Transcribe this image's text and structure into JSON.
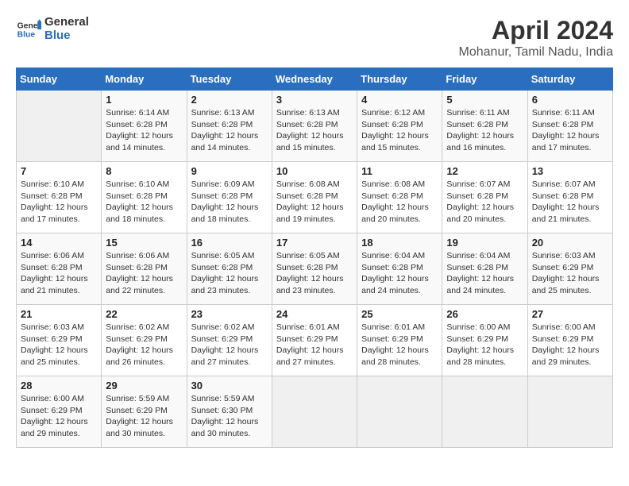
{
  "header": {
    "logo_line1": "General",
    "logo_line2": "Blue",
    "title": "April 2024",
    "subtitle": "Mohanur, Tamil Nadu, India"
  },
  "columns": [
    "Sunday",
    "Monday",
    "Tuesday",
    "Wednesday",
    "Thursday",
    "Friday",
    "Saturday"
  ],
  "rows": [
    [
      {
        "day": "",
        "info": ""
      },
      {
        "day": "1",
        "info": "Sunrise: 6:14 AM\nSunset: 6:28 PM\nDaylight: 12 hours\nand 14 minutes."
      },
      {
        "day": "2",
        "info": "Sunrise: 6:13 AM\nSunset: 6:28 PM\nDaylight: 12 hours\nand 14 minutes."
      },
      {
        "day": "3",
        "info": "Sunrise: 6:13 AM\nSunset: 6:28 PM\nDaylight: 12 hours\nand 15 minutes."
      },
      {
        "day": "4",
        "info": "Sunrise: 6:12 AM\nSunset: 6:28 PM\nDaylight: 12 hours\nand 15 minutes."
      },
      {
        "day": "5",
        "info": "Sunrise: 6:11 AM\nSunset: 6:28 PM\nDaylight: 12 hours\nand 16 minutes."
      },
      {
        "day": "6",
        "info": "Sunrise: 6:11 AM\nSunset: 6:28 PM\nDaylight: 12 hours\nand 17 minutes."
      }
    ],
    [
      {
        "day": "7",
        "info": "Sunrise: 6:10 AM\nSunset: 6:28 PM\nDaylight: 12 hours\nand 17 minutes."
      },
      {
        "day": "8",
        "info": "Sunrise: 6:10 AM\nSunset: 6:28 PM\nDaylight: 12 hours\nand 18 minutes."
      },
      {
        "day": "9",
        "info": "Sunrise: 6:09 AM\nSunset: 6:28 PM\nDaylight: 12 hours\nand 18 minutes."
      },
      {
        "day": "10",
        "info": "Sunrise: 6:08 AM\nSunset: 6:28 PM\nDaylight: 12 hours\nand 19 minutes."
      },
      {
        "day": "11",
        "info": "Sunrise: 6:08 AM\nSunset: 6:28 PM\nDaylight: 12 hours\nand 20 minutes."
      },
      {
        "day": "12",
        "info": "Sunrise: 6:07 AM\nSunset: 6:28 PM\nDaylight: 12 hours\nand 20 minutes."
      },
      {
        "day": "13",
        "info": "Sunrise: 6:07 AM\nSunset: 6:28 PM\nDaylight: 12 hours\nand 21 minutes."
      }
    ],
    [
      {
        "day": "14",
        "info": "Sunrise: 6:06 AM\nSunset: 6:28 PM\nDaylight: 12 hours\nand 21 minutes."
      },
      {
        "day": "15",
        "info": "Sunrise: 6:06 AM\nSunset: 6:28 PM\nDaylight: 12 hours\nand 22 minutes."
      },
      {
        "day": "16",
        "info": "Sunrise: 6:05 AM\nSunset: 6:28 PM\nDaylight: 12 hours\nand 23 minutes."
      },
      {
        "day": "17",
        "info": "Sunrise: 6:05 AM\nSunset: 6:28 PM\nDaylight: 12 hours\nand 23 minutes."
      },
      {
        "day": "18",
        "info": "Sunrise: 6:04 AM\nSunset: 6:28 PM\nDaylight: 12 hours\nand 24 minutes."
      },
      {
        "day": "19",
        "info": "Sunrise: 6:04 AM\nSunset: 6:28 PM\nDaylight: 12 hours\nand 24 minutes."
      },
      {
        "day": "20",
        "info": "Sunrise: 6:03 AM\nSunset: 6:29 PM\nDaylight: 12 hours\nand 25 minutes."
      }
    ],
    [
      {
        "day": "21",
        "info": "Sunrise: 6:03 AM\nSunset: 6:29 PM\nDaylight: 12 hours\nand 25 minutes."
      },
      {
        "day": "22",
        "info": "Sunrise: 6:02 AM\nSunset: 6:29 PM\nDaylight: 12 hours\nand 26 minutes."
      },
      {
        "day": "23",
        "info": "Sunrise: 6:02 AM\nSunset: 6:29 PM\nDaylight: 12 hours\nand 27 minutes."
      },
      {
        "day": "24",
        "info": "Sunrise: 6:01 AM\nSunset: 6:29 PM\nDaylight: 12 hours\nand 27 minutes."
      },
      {
        "day": "25",
        "info": "Sunrise: 6:01 AM\nSunset: 6:29 PM\nDaylight: 12 hours\nand 28 minutes."
      },
      {
        "day": "26",
        "info": "Sunrise: 6:00 AM\nSunset: 6:29 PM\nDaylight: 12 hours\nand 28 minutes."
      },
      {
        "day": "27",
        "info": "Sunrise: 6:00 AM\nSunset: 6:29 PM\nDaylight: 12 hours\nand 29 minutes."
      }
    ],
    [
      {
        "day": "28",
        "info": "Sunrise: 6:00 AM\nSunset: 6:29 PM\nDaylight: 12 hours\nand 29 minutes."
      },
      {
        "day": "29",
        "info": "Sunrise: 5:59 AM\nSunset: 6:29 PM\nDaylight: 12 hours\nand 30 minutes."
      },
      {
        "day": "30",
        "info": "Sunrise: 5:59 AM\nSunset: 6:30 PM\nDaylight: 12 hours\nand 30 minutes."
      },
      {
        "day": "",
        "info": ""
      },
      {
        "day": "",
        "info": ""
      },
      {
        "day": "",
        "info": ""
      },
      {
        "day": "",
        "info": ""
      }
    ]
  ]
}
